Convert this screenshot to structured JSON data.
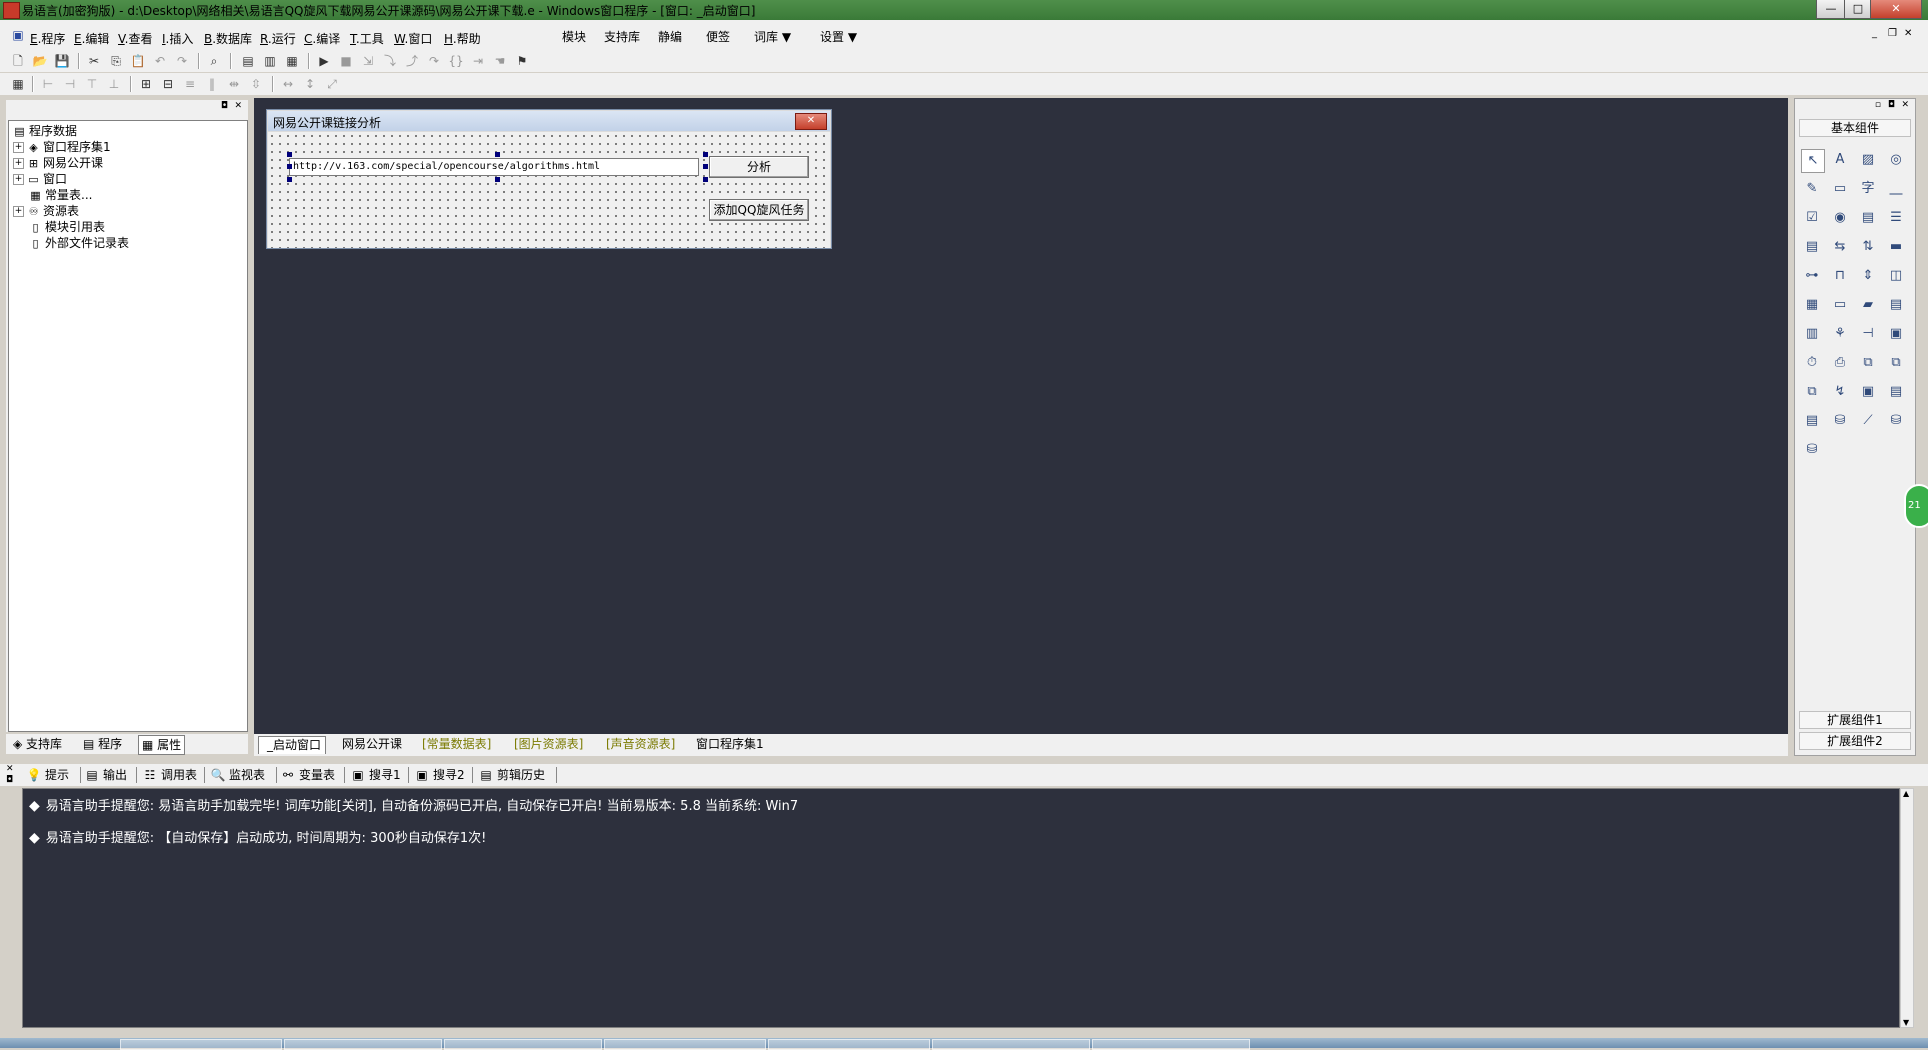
{
  "window": {
    "title": "易语言(加密狗版) - d:\\Desktop\\网络相关\\易语言QQ旋风下载网易公开课源码\\网易公开课下载.e - Windows窗口程序 - [窗口: _启动窗口]",
    "min_label": "—",
    "max_label": "□",
    "close_label": "✕"
  },
  "menu": {
    "items": [
      {
        "hotkey": "E",
        "label": ".程序"
      },
      {
        "hotkey": "E",
        "label": ".编辑"
      },
      {
        "hotkey": "V",
        "label": ".查看"
      },
      {
        "hotkey": "I",
        "label": ".插入"
      },
      {
        "hotkey": "B",
        "label": ".数据库"
      },
      {
        "hotkey": "R",
        "label": ".运行"
      },
      {
        "hotkey": "C",
        "label": ".编译"
      },
      {
        "hotkey": "T",
        "label": ".工具"
      },
      {
        "hotkey": "W",
        "label": ".窗口"
      },
      {
        "hotkey": "H",
        "label": ".帮助"
      }
    ],
    "extra": [
      "模块",
      "支持库",
      "静编",
      "便签",
      "词库 ▼",
      "设置 ▼"
    ]
  },
  "left_panel": {
    "tree": [
      "程序数据",
      "窗口程序集1",
      "网易公开课",
      "窗口",
      "常量表...",
      "资源表",
      "模块引用表",
      "外部文件记录表"
    ],
    "tabs": [
      "支持库",
      "程序",
      "属性"
    ]
  },
  "form": {
    "title": "网易公开课链接分析",
    "url_value": "http://v.163.com/special/opencourse/algorithms.html",
    "analyze_button": "分析",
    "add_task_button": "添加QQ旋风任务"
  },
  "design_tabs": [
    "_启动窗口",
    "网易公开课",
    "[常量数据表]",
    "[图片资源表]",
    "[声音资源表]",
    "窗口程序集1"
  ],
  "right_panel": {
    "header": "基本组件",
    "ext1": "扩展组件1",
    "ext2": "扩展组件2",
    "badge": "21"
  },
  "bottom_tabs": [
    "提示",
    "输出",
    "调用表",
    "监视表",
    "变量表",
    "搜寻1",
    "搜寻2",
    "剪辑历史"
  ],
  "output": {
    "lines": [
      "易语言助手提醒您:  易语言助手加载完毕! 词库功能[关闭], 自动备份源码已开启, 自动保存已开启!  当前易版本: 5.8  当前系统: Win7",
      "易语言助手提醒您: 【自动保存】启动成功, 时间周期为: 300秒自动保存1次!"
    ]
  }
}
